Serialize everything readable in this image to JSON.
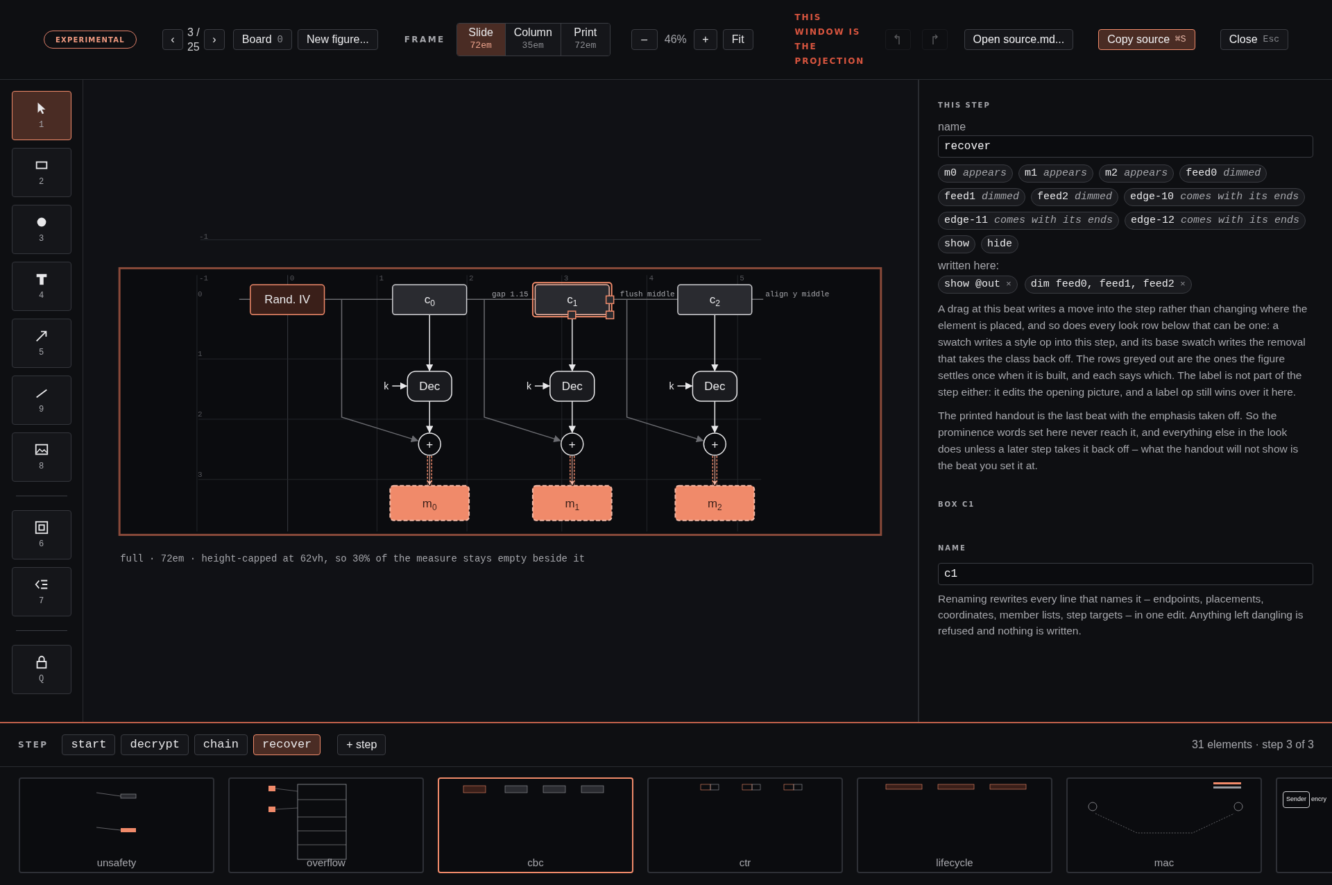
{
  "toolbar": {
    "badge": "EXPERIMENTAL",
    "prev": "‹",
    "page": "3 / 25",
    "next": "›",
    "board": {
      "label": "Board",
      "count": "0"
    },
    "new_figure": "New figure...",
    "frame_label": "FRAME",
    "frames": [
      {
        "label": "Slide",
        "size": "72em",
        "selected": true
      },
      {
        "label": "Column",
        "size": "35em",
        "selected": false
      },
      {
        "label": "Print",
        "size": "72em",
        "selected": false
      }
    ],
    "zoom_out": "–",
    "zoom": "46%",
    "zoom_in": "+",
    "fit": "Fit",
    "notice": "THIS WINDOW IS THE PROJECTION",
    "history": [
      {
        "kind": "undo",
        "disabled": true
      },
      {
        "kind": "redo",
        "disabled": true
      }
    ],
    "actions": [
      {
        "label": "Open source.md...",
        "highlighted": false
      },
      {
        "label": "Copy source",
        "shortcut": "⌘S",
        "highlighted": true
      },
      {
        "label": "Close",
        "shortcut": "Esc",
        "highlighted": false
      }
    ]
  },
  "tool_groups": [
    [
      {
        "key": "1",
        "kind": "pointer",
        "selected": true
      },
      {
        "key": "2",
        "kind": "rect",
        "selected": false
      },
      {
        "key": "3",
        "kind": "circle",
        "selected": false
      },
      {
        "key": "4",
        "kind": "text",
        "selected": false
      },
      {
        "key": "5",
        "kind": "arrow",
        "selected": false
      },
      {
        "key": "9",
        "kind": "line",
        "selected": false
      },
      {
        "key": "8",
        "kind": "image",
        "selected": false
      }
    ],
    [
      {
        "key": "6",
        "kind": "frame",
        "selected": false
      },
      {
        "key": "7",
        "kind": "outline",
        "selected": false
      }
    ],
    [
      {
        "key": "Q",
        "kind": "lock",
        "selected": false
      }
    ]
  ],
  "canvas": {
    "outer_row_label": "-1",
    "column_labels": [
      "-1",
      "0",
      "1",
      "2",
      "3",
      "4",
      "5"
    ],
    "row_labels": [
      "0",
      "1",
      "2",
      "3"
    ],
    "iv": "Rand. IV",
    "columns": [
      {
        "cipher": "c",
        "index": "0",
        "selected": false,
        "key": "k",
        "decrypt": "Dec",
        "sum": "+",
        "message": "m",
        "message_index": "0"
      },
      {
        "cipher": "c",
        "index": "1",
        "selected": true,
        "key": "k",
        "decrypt": "Dec",
        "sum": "+",
        "message": "m",
        "message_index": "1"
      },
      {
        "cipher": "c",
        "index": "2",
        "selected": false,
        "key": "k",
        "decrypt": "Dec",
        "sum": "+",
        "message": "m",
        "message_index": "2"
      }
    ],
    "annotations": [
      "gap 1.15",
      "flush middle",
      "align y middle"
    ],
    "caption": "full · 72em · height-capped at 62vh, so 30% of the measure stays empty beside it"
  },
  "panel": {
    "section": "THIS STEP",
    "name_label": "name",
    "name_value": "recover",
    "effects": [
      {
        "target": "m0",
        "verb": "appears"
      },
      {
        "target": "m1",
        "verb": "appears"
      },
      {
        "target": "m2",
        "verb": "appears"
      },
      {
        "target": "feed0",
        "verb": "dimmed"
      },
      {
        "target": "feed1",
        "verb": "dimmed"
      },
      {
        "target": "feed2",
        "verb": "dimmed"
      },
      {
        "target": "edge-10",
        "verb": "comes with its ends"
      },
      {
        "target": "edge-11",
        "verb": "comes with its ends"
      },
      {
        "target": "edge-12",
        "verb": "comes with its ends"
      },
      {
        "target": "show"
      },
      {
        "target": "hide"
      }
    ],
    "written_label": "written here:",
    "written": [
      {
        "op": "show @out",
        "remove": "×"
      },
      {
        "op": "dim feed0, feed1, feed2",
        "remove": "×"
      }
    ],
    "paragraphs": [
      "A drag at this beat writes a move into the step rather than changing where the element is placed, and so does every look row below that can be one: a swatch writes a style op into this step, and its base swatch writes the removal that takes the class back off. The rows greyed out are the ones the figure settles once when it is built, and each says which. The label is not part of the step either: it edits the opening picture, and a label op still wins over it here.",
      "The printed handout is the last beat with the emphasis taken off. So the prominence words set here never reach it, and everything else in the look does unless a later step takes it back off – what the handout will not show is the beat you set it at."
    ],
    "box_section": "BOX C1",
    "box_name_label": "NAME",
    "box_name_value": "c1",
    "box_help": "Renaming rewrites every line that names it – endpoints, placements, coordinates, member lists, step targets – in one edit. Anything left dangling is refused and nothing is written."
  },
  "step_bar": {
    "label": "STEP",
    "steps": [
      {
        "label": "start",
        "selected": false
      },
      {
        "label": "decrypt",
        "selected": false
      },
      {
        "label": "chain",
        "selected": false
      },
      {
        "label": "recover",
        "selected": true
      }
    ],
    "add": "+ step",
    "summary": "31 elements · step 3 of 3"
  },
  "thumbnails": [
    {
      "kind": "unsafety",
      "label": "unsafety",
      "selected": false
    },
    {
      "kind": "overflow",
      "label": "overflow",
      "selected": false
    },
    {
      "kind": "cbc",
      "label": "cbc",
      "selected": true
    },
    {
      "kind": "ctr",
      "label": "ctr",
      "selected": false
    },
    {
      "kind": "lifecycle",
      "label": "lifecycle",
      "selected": false
    },
    {
      "kind": "mac",
      "label": "mac",
      "selected": false
    },
    {
      "kind": "sender",
      "texts": [
        "Sender",
        "encry"
      ],
      "selected": false
    }
  ]
}
